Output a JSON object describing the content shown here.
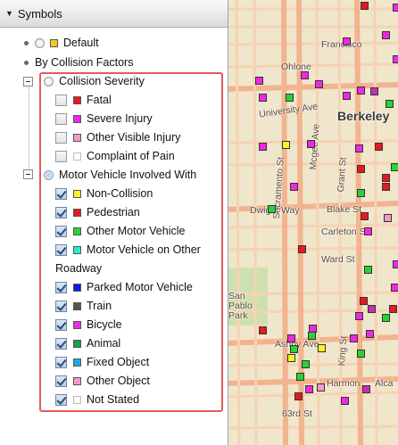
{
  "panel": {
    "title": "Symbols",
    "default": {
      "label": "Default",
      "swatch": "#f2cc1c"
    },
    "by_collision_factors": "By Collision Factors",
    "collision_severity": {
      "label": "Collision Severity",
      "items": [
        {
          "label": "Fatal",
          "color": "#e8191e",
          "checked": false
        },
        {
          "label": "Severe Injury",
          "color": "#ee28e3",
          "checked": false
        },
        {
          "label": "Other Visible Injury",
          "color": "#f29bc7",
          "checked": false
        },
        {
          "label": "Complaint of Pain",
          "color": "#ffffff",
          "checked": false
        }
      ]
    },
    "motor_vehicle": {
      "label": "Motor Vehicle Involved With",
      "items": [
        {
          "label": "Non-Collision",
          "color": "#fbf51e",
          "checked": true
        },
        {
          "label": "Pedestrian",
          "color": "#e8191e",
          "checked": true
        },
        {
          "label": "Other Motor Vehicle",
          "color": "#28d435",
          "checked": true
        },
        {
          "label": "Motor Vehicle on Other",
          "label2": "Roadway",
          "color": "#22eed6",
          "checked": true
        },
        {
          "label": "Parked Motor Vehicle",
          "color": "#1018e6",
          "checked": true
        },
        {
          "label": "Train",
          "color": "#555555",
          "checked": true
        },
        {
          "label": "Bicycle",
          "color": "#ee28e3",
          "checked": true
        },
        {
          "label": "Animal",
          "color": "#15a34a",
          "checked": true
        },
        {
          "label": "Fixed Object",
          "color": "#1fa7e6",
          "checked": true
        },
        {
          "label": "Other Object",
          "color": "#f29bc7",
          "checked": true
        },
        {
          "label": "Not Stated",
          "color": "#ffffff",
          "checked": true
        }
      ]
    }
  },
  "map": {
    "labels": {
      "francisco": "Francisco",
      "ohlone": "Ohlone",
      "university": "University Ave",
      "berkeley": "Berkeley",
      "sacramento": "Sacramento St",
      "mcgee": "Mcgee Ave",
      "grant": "Grant St",
      "dwight": "Dwight Way",
      "blake": "Blake St",
      "carleton": "Carleton St",
      "ward": "Ward St",
      "san_pablo": "San Pablo Park",
      "ashby": "Ashby Ave",
      "king": "King St",
      "harmon": "Harmon",
      "alcatraz": "Alca",
      "st63": "63rd St"
    }
  }
}
